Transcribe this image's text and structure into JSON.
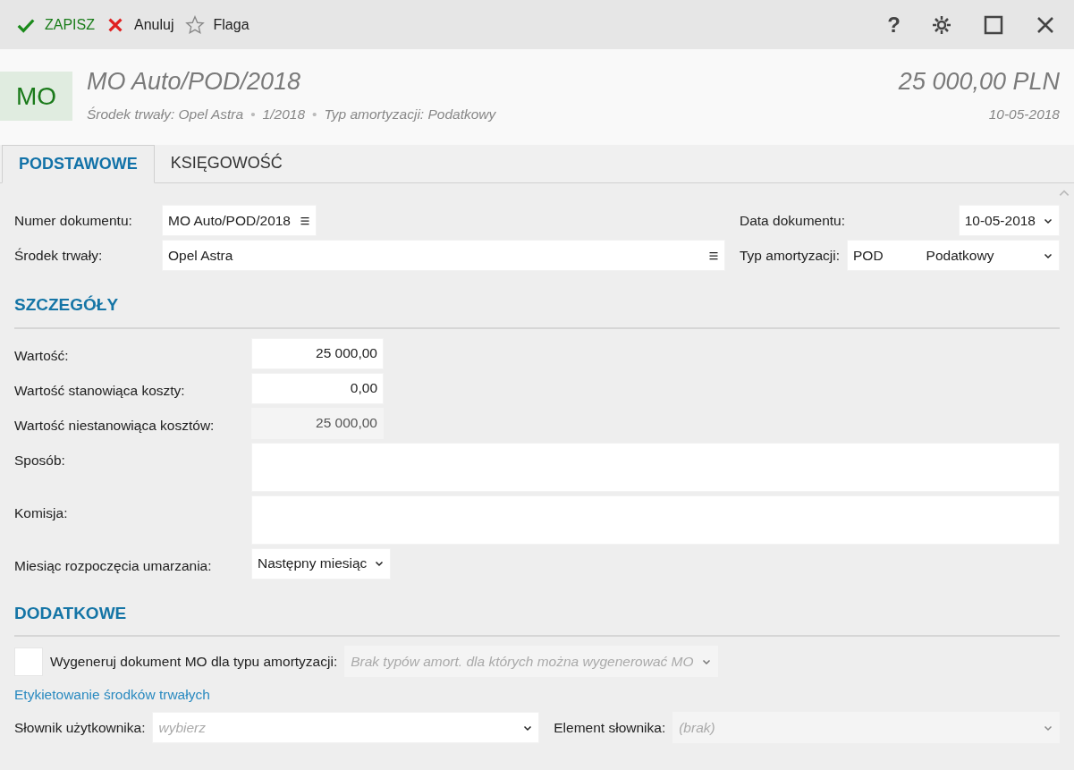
{
  "toolbar": {
    "actions": [
      {
        "kind": "save",
        "label": "ZAPISZ"
      },
      {
        "kind": "cancel",
        "label": "Anuluj"
      },
      {
        "kind": "flag",
        "label": "Flaga"
      }
    ],
    "window_controls": [
      {
        "kind": "help",
        "label": "?"
      },
      {
        "kind": "settings"
      },
      {
        "kind": "maximize"
      },
      {
        "kind": "close"
      }
    ]
  },
  "header": {
    "badge": "MO",
    "title": "MO Auto/POD/2018",
    "meta": [
      "Środek trwały: Opel Astra",
      "1/2018",
      "Typ amortyzacji: Podatkowy"
    ],
    "meta_separator": "•",
    "amount": "25 000,00 PLN",
    "date": "10-05-2018"
  },
  "tabs": [
    {
      "label": "PODSTAWOWE",
      "selected": true
    },
    {
      "label": "KSIĘGOWOŚĆ",
      "selected": false
    }
  ],
  "main": {
    "left": [
      {
        "label": "Numer dokumentu:",
        "kind": "lookup",
        "value": "MO Auto/POD/2018",
        "wide": false
      },
      {
        "label": "Środek trwały:",
        "kind": "lookup",
        "value": "Opel Astra",
        "wide": true
      }
    ],
    "right": [
      {
        "label": "Data dokumentu:",
        "kind": "select",
        "value": "10-05-2018"
      },
      {
        "label": "Typ amortyzacji:",
        "kind": "select",
        "code": "POD",
        "value": "Podatkowy"
      }
    ]
  },
  "sections": [
    {
      "title": "SZCZEGÓŁY",
      "rows": [
        {
          "label": "Wartość:",
          "kind": "number",
          "value": "25 000,00",
          "disabled": false
        },
        {
          "label": "Wartość stanowiąca koszty:",
          "kind": "number",
          "value": "0,00",
          "disabled": false
        },
        {
          "label": "Wartość niestanowiąca kosztów:",
          "kind": "number",
          "value": "25 000,00",
          "disabled": true
        },
        {
          "label": "Sposób:",
          "kind": "textarea"
        },
        {
          "label": "Komisja:",
          "kind": "textarea"
        },
        {
          "label": "Miesiąc rozpoczęcia umarzania:",
          "kind": "select",
          "value": "Następny miesiąc"
        }
      ]
    },
    {
      "title": "DODATKOWE",
      "checkbox": {
        "label": "Wygeneruj dokument MO dla typu amortyzacji:",
        "checked": false,
        "select_placeholder": "Brak typów amort. dla których można wygenerować MO"
      },
      "link": "Etykietowanie środków trwałych",
      "dictionary": [
        {
          "label": "Słownik użytkownika:",
          "placeholder": "wybierz",
          "disabled": false
        },
        {
          "label": "Element słownika:",
          "placeholder": "(brak)",
          "disabled": true
        }
      ]
    }
  ]
}
